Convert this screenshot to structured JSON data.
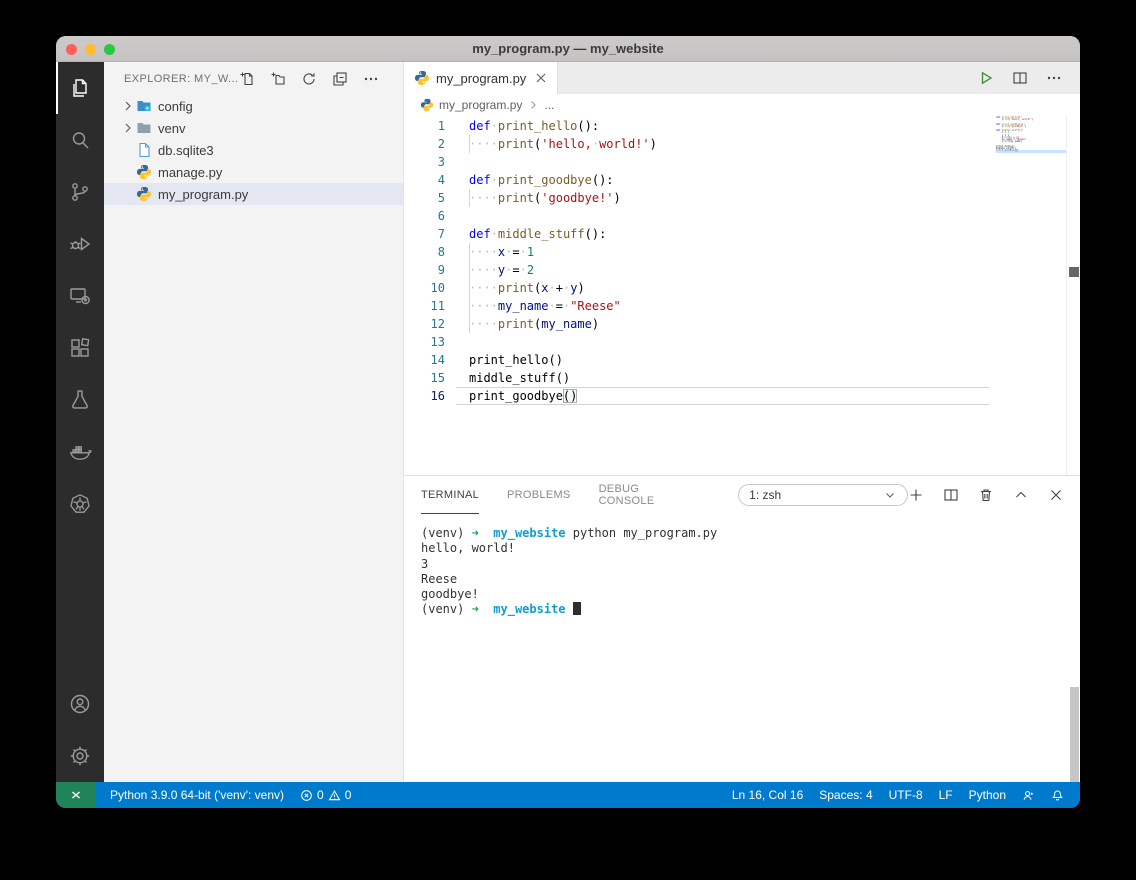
{
  "window": {
    "title": "my_program.py — my_website"
  },
  "activity_bar": {
    "active": "explorer",
    "items": [
      "explorer",
      "search",
      "source-control",
      "run-and-debug",
      "remote-explorer",
      "extensions",
      "testing",
      "docker",
      "kubernetes"
    ],
    "bottom_items": [
      "accounts",
      "settings"
    ]
  },
  "explorer": {
    "title": "EXPLORER: MY_W...",
    "actions": [
      "new-file",
      "new-folder",
      "refresh-explorer",
      "collapse-folders",
      "more-actions"
    ],
    "tree": [
      {
        "label": "config",
        "type": "folder",
        "collapsed": true
      },
      {
        "label": "venv",
        "type": "folder",
        "collapsed": true
      },
      {
        "label": "db.sqlite3",
        "type": "file"
      },
      {
        "label": "manage.py",
        "type": "python-file"
      },
      {
        "label": "my_program.py",
        "type": "python-file",
        "selected": true
      }
    ]
  },
  "editor": {
    "tab": {
      "label": "my_program.py"
    },
    "actions": [
      "run-python-file",
      "split-editor",
      "more-actions"
    ],
    "breadcrumb": {
      "file": "my_program.py",
      "ellipsis": "..."
    },
    "code": {
      "language": "python",
      "lines": [
        {
          "n": 1,
          "tokens": [
            [
              "kw",
              "def"
            ],
            [
              "ws",
              "·"
            ],
            [
              "fn",
              "print_hello"
            ],
            [
              "pl",
              "():"
            ]
          ]
        },
        {
          "n": 2,
          "guide": true,
          "tokens": [
            [
              "ws",
              "····"
            ],
            [
              "fn",
              "print"
            ],
            [
              "pl",
              "("
            ],
            [
              "str",
              "'hello,"
            ],
            [
              "ws",
              "·"
            ],
            [
              "str",
              "world!'"
            ],
            [
              "pl",
              ")"
            ]
          ]
        },
        {
          "n": 3,
          "tokens": []
        },
        {
          "n": 4,
          "tokens": [
            [
              "kw",
              "def"
            ],
            [
              "ws",
              "·"
            ],
            [
              "fn",
              "print_goodbye"
            ],
            [
              "pl",
              "():"
            ]
          ]
        },
        {
          "n": 5,
          "guide": true,
          "tokens": [
            [
              "ws",
              "····"
            ],
            [
              "fn",
              "print"
            ],
            [
              "pl",
              "("
            ],
            [
              "str",
              "'goodbye!'"
            ],
            [
              "pl",
              ")"
            ]
          ]
        },
        {
          "n": 6,
          "tokens": []
        },
        {
          "n": 7,
          "tokens": [
            [
              "kw",
              "def"
            ],
            [
              "ws",
              "·"
            ],
            [
              "fn",
              "middle_stuff"
            ],
            [
              "pl",
              "():"
            ]
          ]
        },
        {
          "n": 8,
          "guide": true,
          "tokens": [
            [
              "ws",
              "····"
            ],
            [
              "var",
              "x"
            ],
            [
              "ws",
              "·"
            ],
            [
              "pl",
              "="
            ],
            [
              "ws",
              "·"
            ],
            [
              "num",
              "1"
            ]
          ]
        },
        {
          "n": 9,
          "guide": true,
          "tokens": [
            [
              "ws",
              "····"
            ],
            [
              "var",
              "y"
            ],
            [
              "ws",
              "·"
            ],
            [
              "pl",
              "="
            ],
            [
              "ws",
              "·"
            ],
            [
              "num",
              "2"
            ]
          ]
        },
        {
          "n": 10,
          "guide": true,
          "tokens": [
            [
              "ws",
              "····"
            ],
            [
              "fn",
              "print"
            ],
            [
              "pl",
              "("
            ],
            [
              "var",
              "x"
            ],
            [
              "ws",
              "·"
            ],
            [
              "pl",
              "+"
            ],
            [
              "ws",
              "·"
            ],
            [
              "var",
              "y"
            ],
            [
              "pl",
              ")"
            ]
          ]
        },
        {
          "n": 11,
          "guide": true,
          "tokens": [
            [
              "ws",
              "····"
            ],
            [
              "var",
              "my_name"
            ],
            [
              "ws",
              "·"
            ],
            [
              "pl",
              "="
            ],
            [
              "ws",
              "·"
            ],
            [
              "str",
              "\"Reese\""
            ]
          ]
        },
        {
          "n": 12,
          "guide": true,
          "tokens": [
            [
              "ws",
              "····"
            ],
            [
              "fn",
              "print"
            ],
            [
              "pl",
              "("
            ],
            [
              "var",
              "my_name"
            ],
            [
              "pl",
              ")"
            ]
          ]
        },
        {
          "n": 13,
          "tokens": []
        },
        {
          "n": 14,
          "tokens": [
            [
              "pl",
              "print_hello()"
            ]
          ]
        },
        {
          "n": 15,
          "tokens": [
            [
              "pl",
              "middle_stuff()"
            ]
          ]
        },
        {
          "n": 16,
          "current": true,
          "tokens": [
            [
              "pl",
              "print_goodbye"
            ],
            [
              "bkt",
              "()"
            ]
          ]
        }
      ]
    }
  },
  "panel": {
    "tabs": [
      {
        "label": "TERMINAL",
        "active": true
      },
      {
        "label": "PROBLEMS"
      },
      {
        "label": "DEBUG CONSOLE"
      }
    ],
    "shell_selector": {
      "value": "1: zsh"
    },
    "actions": [
      "new-terminal",
      "split-terminal",
      "kill-terminal",
      "maximize-panel",
      "close-panel"
    ],
    "terminal": {
      "lines": [
        [
          [
            "pl",
            "(venv) "
          ],
          [
            "arrow",
            "➜"
          ],
          [
            "pl",
            "  "
          ],
          [
            "cwd",
            "my_website"
          ],
          [
            "pl",
            " python my_program.py"
          ]
        ],
        [
          [
            "pl",
            "hello, world!"
          ]
        ],
        [
          [
            "pl",
            "3"
          ]
        ],
        [
          [
            "pl",
            "Reese"
          ]
        ],
        [
          [
            "pl",
            "goodbye!"
          ]
        ],
        [
          [
            "pl",
            "(venv) "
          ],
          [
            "arrow",
            "➜"
          ],
          [
            "pl",
            "  "
          ],
          [
            "cwd",
            "my_website"
          ],
          [
            "pl",
            " "
          ],
          [
            "cursor",
            ""
          ]
        ]
      ]
    }
  },
  "status_bar": {
    "python_version": "Python 3.9.0 64-bit ('venv': venv)",
    "errors": "0",
    "warnings": "0",
    "cursor_position": "Ln 16, Col 16",
    "indentation": "Spaces: 4",
    "encoding": "UTF-8",
    "eol": "LF",
    "language": "Python"
  },
  "colors": {
    "status_bar_bg": "#007ACC",
    "remote_indicator_bg": "#218358",
    "selection_bg": "#E4E6F1",
    "keyword": "#0000FF",
    "function": "#795E26",
    "string": "#A31515",
    "number": "#098658",
    "variable": "#001080",
    "line_number": "#237893",
    "terminal_green": "#22A24C",
    "terminal_cyan": "#0E9FD0",
    "python_logo_blue": "#366994",
    "python_logo_yellow": "#FFC331",
    "run_button_green": "#388A34"
  }
}
